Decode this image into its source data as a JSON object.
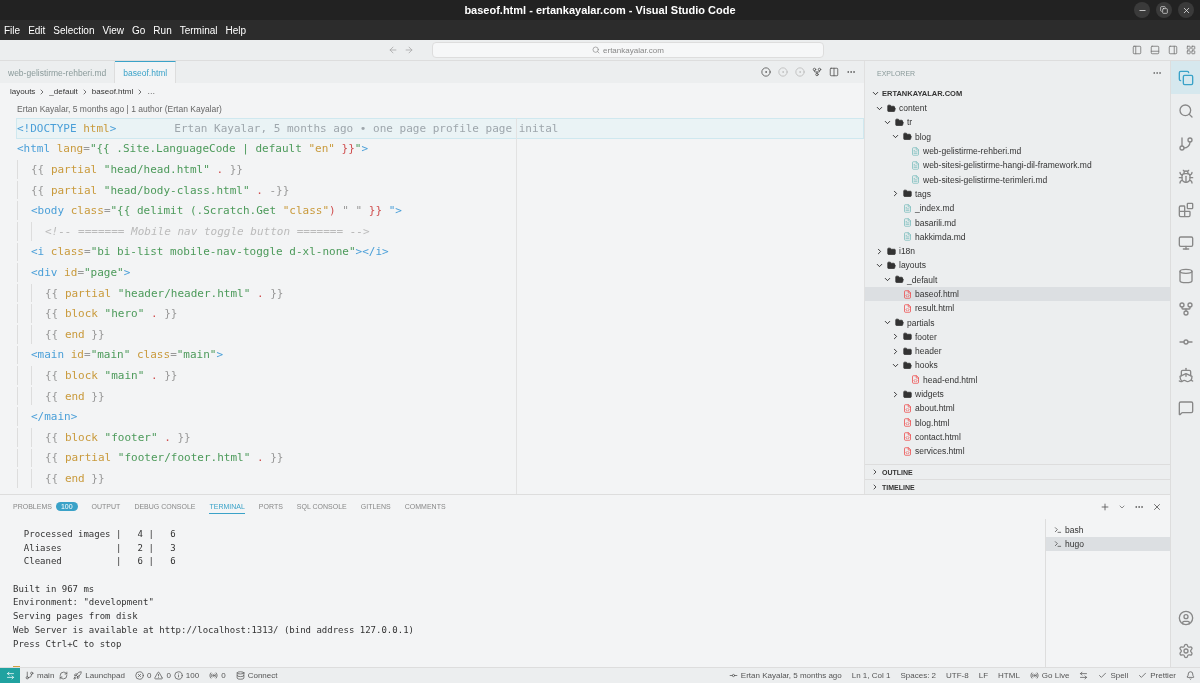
{
  "window": {
    "title": "baseof.html - ertankayalar.com - Visual Studio Code"
  },
  "menu": [
    "File",
    "Edit",
    "Selection",
    "View",
    "Go",
    "Run",
    "Terminal",
    "Help"
  ],
  "command_center": {
    "placeholder": "ertankayalar.com"
  },
  "editor_tabs": [
    {
      "label": "web-gelistirme-rehberi.md",
      "selected": false
    },
    {
      "label": "baseof.html",
      "selected": true
    }
  ],
  "breadcrumbs": [
    "layouts",
    "_default",
    "baseof.html",
    "…"
  ],
  "codelens": "Ertan Kayalar, 5 months ago | 1 author (Ertan Kayalar)",
  "code": [
    {
      "tokens": [
        {
          "kind": "tag",
          "text": "<!DOCTYPE"
        },
        {
          "kind": "attr",
          "text": " html"
        },
        {
          "kind": "tag",
          "text": ">"
        }
      ],
      "blame": "Ertan Kayalar, 5 months ago • one page profile page inital",
      "current": true
    },
    {
      "tokens": [
        {
          "kind": "tag",
          "text": "<html"
        },
        {
          "kind": "attr",
          "text": " lang"
        },
        {
          "kind": "punct",
          "text": "="
        },
        {
          "kind": "str",
          "text": "\"{{ .Site.LanguageCode | default "
        },
        {
          "kind": "attr",
          "text": "\"en\""
        },
        {
          "kind": "red",
          "text": " }}"
        },
        {
          "kind": "str",
          "text": "\""
        },
        {
          "kind": "tag",
          "text": ">"
        }
      ],
      "current": false,
      "children": [
        {
          "tokens": [
            {
              "kind": "punct",
              "text": "{{ "
            },
            {
              "kind": "attr",
              "text": "partial"
            },
            {
              "kind": "str",
              "text": " \"head/head.html\""
            },
            {
              "kind": "red",
              "text": " ."
            },
            {
              "kind": "punct",
              "text": " }}"
            }
          ],
          "current": false
        },
        {
          "tokens": [
            {
              "kind": "punct",
              "text": "{{ "
            },
            {
              "kind": "attr",
              "text": "partial"
            },
            {
              "kind": "str",
              "text": " \"head/body-class.html\""
            },
            {
              "kind": "red",
              "text": " ."
            },
            {
              "kind": "punct",
              "text": " -}}"
            }
          ],
          "current": false
        },
        {
          "tokens": [
            {
              "kind": "tag",
              "text": "<body"
            },
            {
              "kind": "attr",
              "text": " class"
            },
            {
              "kind": "punct",
              "text": "="
            },
            {
              "kind": "str",
              "text": "\"{{ delimit (.Scratch.Get "
            },
            {
              "kind": "attr",
              "text": "\"class\""
            },
            {
              "kind": "red",
              "text": ")"
            },
            {
              "kind": "punct",
              "text": " \" \""
            },
            {
              "kind": "red",
              "text": " }}"
            },
            {
              "kind": "tag",
              "text": " \">"
            }
          ],
          "current": false,
          "children": [
            {
              "tokens": [
                {
                  "kind": "comment",
                  "text": "<!-- ======= Mobile nav toggle button ======= -->"
                }
              ],
              "current": false
            }
          ]
        },
        {
          "tokens": [
            {
              "kind": "tag",
              "text": "<i"
            },
            {
              "kind": "attr",
              "text": " class"
            },
            {
              "kind": "punct",
              "text": "="
            },
            {
              "kind": "str",
              "text": "\"bi bi-list mobile-nav-toggle d-xl-none\""
            },
            {
              "kind": "tag",
              "text": "></i>"
            }
          ],
          "current": false
        },
        {
          "tokens": [
            {
              "kind": "tag",
              "text": "<div"
            },
            {
              "kind": "attr",
              "text": " id"
            },
            {
              "kind": "punct",
              "text": "="
            },
            {
              "kind": "str",
              "text": "\"page\""
            },
            {
              "kind": "tag",
              "text": ">"
            }
          ],
          "current": false,
          "children": [
            {
              "tokens": [
                {
                  "kind": "punct",
                  "text": "{{ "
                },
                {
                  "kind": "attr",
                  "text": "partial"
                },
                {
                  "kind": "str",
                  "text": " \"header/header.html\""
                },
                {
                  "kind": "red",
                  "text": " ."
                },
                {
                  "kind": "punct",
                  "text": " }}"
                }
              ],
              "current": false
            },
            {
              "tokens": [
                {
                  "kind": "punct",
                  "text": "{{ "
                },
                {
                  "kind": "attr",
                  "text": "block"
                },
                {
                  "kind": "str",
                  "text": " \"hero\""
                },
                {
                  "kind": "red",
                  "text": " ."
                },
                {
                  "kind": "punct",
                  "text": " }}"
                }
              ],
              "current": false
            },
            {
              "tokens": [
                {
                  "kind": "punct",
                  "text": "{{ "
                },
                {
                  "kind": "attr",
                  "text": "end"
                },
                {
                  "kind": "punct",
                  "text": " }}"
                }
              ],
              "current": false
            }
          ]
        },
        {
          "tokens": [
            {
              "kind": "tag",
              "text": "<main"
            },
            {
              "kind": "attr",
              "text": " id"
            },
            {
              "kind": "punct",
              "text": "="
            },
            {
              "kind": "str",
              "text": "\"main\""
            },
            {
              "kind": "attr",
              "text": " class"
            },
            {
              "kind": "punct",
              "text": "="
            },
            {
              "kind": "str",
              "text": "\"main\""
            },
            {
              "kind": "tag",
              "text": ">"
            }
          ],
          "current": false,
          "children": [
            {
              "tokens": [
                {
                  "kind": "punct",
                  "text": "{{ "
                },
                {
                  "kind": "attr",
                  "text": "block"
                },
                {
                  "kind": "str",
                  "text": " \"main\""
                },
                {
                  "kind": "red",
                  "text": " ."
                },
                {
                  "kind": "punct",
                  "text": " }}"
                }
              ],
              "current": false
            },
            {
              "tokens": [
                {
                  "kind": "punct",
                  "text": "{{ "
                },
                {
                  "kind": "attr",
                  "text": "end"
                },
                {
                  "kind": "punct",
                  "text": " }}"
                }
              ],
              "current": false
            }
          ]
        },
        {
          "tokens": [
            {
              "kind": "tag",
              "text": "</main>"
            }
          ],
          "current": false,
          "children": [
            {
              "tokens": [
                {
                  "kind": "punct",
                  "text": "{{ "
                },
                {
                  "kind": "attr",
                  "text": "block"
                },
                {
                  "kind": "str",
                  "text": " \"footer\""
                },
                {
                  "kind": "red",
                  "text": " ."
                },
                {
                  "kind": "punct",
                  "text": " }}"
                }
              ],
              "current": false
            },
            {
              "tokens": [
                {
                  "kind": "punct",
                  "text": "{{ "
                },
                {
                  "kind": "attr",
                  "text": "partial"
                },
                {
                  "kind": "str",
                  "text": " \"footer/footer.html\""
                },
                {
                  "kind": "red",
                  "text": " ."
                },
                {
                  "kind": "punct",
                  "text": " }}"
                }
              ],
              "current": false
            },
            {
              "tokens": [
                {
                  "kind": "punct",
                  "text": "{{ "
                },
                {
                  "kind": "attr",
                  "text": "end"
                },
                {
                  "kind": "punct",
                  "text": " }}"
                }
              ],
              "current": false
            }
          ]
        }
      ]
    }
  ],
  "sidebar": {
    "title": "EXPLORER",
    "root": "ERTANKAYALAR.COM",
    "items": [
      {
        "label": "content",
        "kind": "folder",
        "expanded": true,
        "selected": false,
        "children": [
          {
            "label": "tr",
            "kind": "folder",
            "expanded": true,
            "selected": false,
            "children": [
              {
                "label": "blog",
                "kind": "folder",
                "expanded": true,
                "selected": false,
                "children": [
                  {
                    "label": "web-gelistirme-rehberi.md",
                    "kind": "md",
                    "selected": false
                  },
                  {
                    "label": "web-sitesi-gelistirme-hangi-dil-framework.md",
                    "kind": "md",
                    "selected": false
                  },
                  {
                    "label": "web-sitesi-gelistirme-terimleri.md",
                    "kind": "md",
                    "selected": false
                  }
                ]
              },
              {
                "label": "tags",
                "kind": "folder",
                "expanded": false,
                "selected": false
              },
              {
                "label": "_index.md",
                "kind": "md",
                "selected": false
              },
              {
                "label": "basarili.md",
                "kind": "md",
                "selected": false
              },
              {
                "label": "hakkimda.md",
                "kind": "md",
                "selected": false
              }
            ]
          }
        ]
      },
      {
        "label": "i18n",
        "kind": "folder",
        "expanded": false,
        "selected": false
      },
      {
        "label": "layouts",
        "kind": "folder",
        "expanded": true,
        "selected": false,
        "children": [
          {
            "label": "_default",
            "kind": "folder",
            "expanded": true,
            "selected": false,
            "children": [
              {
                "label": "baseof.html",
                "kind": "html",
                "selected": true
              },
              {
                "label": "result.html",
                "kind": "html",
                "selected": false
              }
            ]
          },
          {
            "label": "partials",
            "kind": "folder",
            "expanded": true,
            "selected": false,
            "children": [
              {
                "label": "footer",
                "kind": "folder",
                "expanded": false,
                "selected": false
              },
              {
                "label": "header",
                "kind": "folder",
                "expanded": false,
                "selected": false
              },
              {
                "label": "hooks",
                "kind": "folder",
                "expanded": true,
                "selected": false,
                "children": [
                  {
                    "label": "head-end.html",
                    "kind": "html",
                    "selected": false
                  }
                ]
              },
              {
                "label": "widgets",
                "kind": "folder",
                "expanded": false,
                "selected": false
              },
              {
                "label": "about.html",
                "kind": "html",
                "selected": false
              },
              {
                "label": "blog.html",
                "kind": "html",
                "selected": false
              },
              {
                "label": "contact.html",
                "kind": "html",
                "selected": false
              },
              {
                "label": "services.html",
                "kind": "html",
                "selected": false
              }
            ]
          }
        ]
      }
    ],
    "sections": [
      "OUTLINE",
      "TIMELINE"
    ]
  },
  "panel": {
    "tabs": [
      {
        "label": "PROBLEMS",
        "badge": "100",
        "selected": false
      },
      {
        "label": "OUTPUT",
        "selected": false
      },
      {
        "label": "DEBUG CONSOLE",
        "selected": false
      },
      {
        "label": "TERMINAL",
        "selected": true
      },
      {
        "label": "PORTS",
        "selected": false
      },
      {
        "label": "SQL CONSOLE",
        "selected": false
      },
      {
        "label": "GITLENS",
        "selected": false
      },
      {
        "label": "COMMENTS",
        "selected": false
      }
    ],
    "terminal_blocks": [
      [
        "  Processed images |   4 |   6",
        "  Aliases          |   2 |   3",
        "  Cleaned          |   6 |   6"
      ],
      [
        "Built in 967 ms",
        "Environment: \"development\"",
        "Serving pages from disk",
        "Web Server is available at http://localhost:1313/ (bind address 127.0.0.1)",
        "Press Ctrl+C to stop"
      ]
    ],
    "terminals": [
      {
        "label": "bash",
        "selected": false
      },
      {
        "label": "hugo",
        "selected": true
      }
    ]
  },
  "status_bar": {
    "left": [
      {
        "kind": "branch",
        "text": "main"
      },
      {
        "kind": "launchpad",
        "text": "Launchpad"
      },
      {
        "kind": "problems",
        "errors": "0",
        "warnings": "0",
        "info": "100"
      },
      {
        "kind": "ports",
        "text": "0"
      },
      {
        "kind": "connect",
        "text": "Connect"
      }
    ],
    "right": [
      {
        "kind": "blame",
        "text": "Ertan Kayalar, 5 months ago"
      },
      {
        "kind": "text",
        "text": "Ln 1, Col 1"
      },
      {
        "kind": "text",
        "text": "Spaces: 2"
      },
      {
        "kind": "text",
        "text": "UTF-8"
      },
      {
        "kind": "text",
        "text": "LF"
      },
      {
        "kind": "text",
        "text": "HTML"
      },
      {
        "kind": "golive",
        "text": "Go Live"
      },
      {
        "kind": "spell",
        "text": "Spell"
      },
      {
        "kind": "prettier",
        "text": "Prettier"
      }
    ]
  }
}
